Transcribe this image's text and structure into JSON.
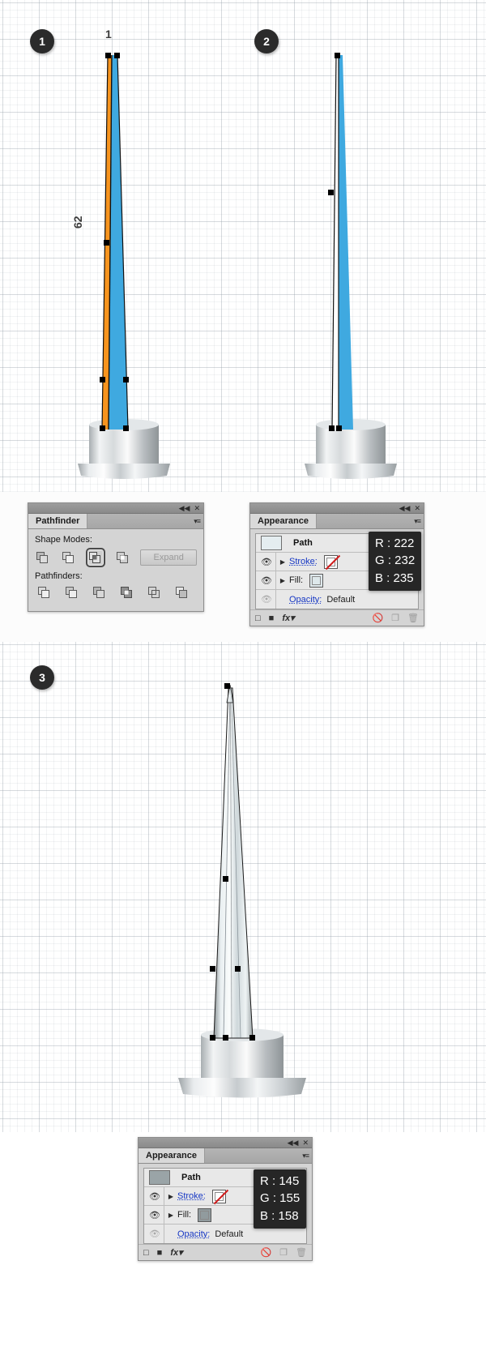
{
  "steps": [
    {
      "number": "1"
    },
    {
      "number": "2"
    },
    {
      "number": "3"
    }
  ],
  "measurements": {
    "top_label": "1",
    "side_label": "62"
  },
  "pathfinder_panel": {
    "title": "Pathfinder",
    "collapse_icon": "◀◀",
    "close_icon": "✕",
    "menu_icon": "▾≡",
    "shape_modes_label": "Shape Modes:",
    "pathfinders_label": "Pathfinders:",
    "expand_label": "Expand",
    "shape_mode_buttons": [
      {
        "name": "unite",
        "selected": false
      },
      {
        "name": "minus-front",
        "selected": false
      },
      {
        "name": "intersect",
        "selected": true
      },
      {
        "name": "exclude",
        "selected": false
      }
    ],
    "pathfinder_buttons": [
      {
        "name": "divide"
      },
      {
        "name": "trim"
      },
      {
        "name": "merge"
      },
      {
        "name": "crop"
      },
      {
        "name": "outline"
      },
      {
        "name": "minus-back"
      }
    ]
  },
  "appearance_panel_top": {
    "title": "Appearance",
    "collapse_icon": "◀◀",
    "close_icon": "✕",
    "menu_icon": "▾≡",
    "object_label": "Path",
    "stroke_label": "Stroke:",
    "fill_label": "Fill:",
    "opacity_label": "Opacity:",
    "opacity_value": "Default",
    "stroke_swatch": "none",
    "fill_color": "#dee8eb",
    "footer_icons": [
      "add-new-stroke",
      "add-new-fill",
      "add-new-effect",
      "clear-appearance",
      "duplicate-item",
      "delete-item"
    ],
    "fx_label": "fx",
    "rgb_tooltip": {
      "r": "R : 222",
      "g": "G : 232",
      "b": "B : 235"
    }
  },
  "appearance_panel_bottom": {
    "title": "Appearance",
    "collapse_icon": "◀◀",
    "close_icon": "✕",
    "menu_icon": "▾≡",
    "object_label": "Path",
    "stroke_label": "Stroke:",
    "fill_label": "Fill:",
    "opacity_label": "Opacity:",
    "opacity_value": "Default",
    "stroke_swatch": "none",
    "fill_color": "#919b9e",
    "footer_icons": [
      "add-new-stroke",
      "add-new-fill",
      "add-new-effect",
      "clear-appearance",
      "duplicate-item",
      "delete-item"
    ],
    "fx_label": "fx",
    "rgb_tooltip": {
      "r": "R : 145",
      "g": "G : 155",
      "b": "B : 158"
    }
  },
  "artwork": {
    "colors": {
      "orange": "#f7941e",
      "blue": "#3fa9e0",
      "blue_light": "#5cbdea",
      "white": "#ffffff",
      "outline": "#111111",
      "metal_light": "#fbfbfb",
      "metal_mid": "#c9ccce",
      "metal_dark": "#8e9497",
      "spike_fill_light": "#e7eef1",
      "spike_fill_mid": "#c4ced2"
    }
  }
}
